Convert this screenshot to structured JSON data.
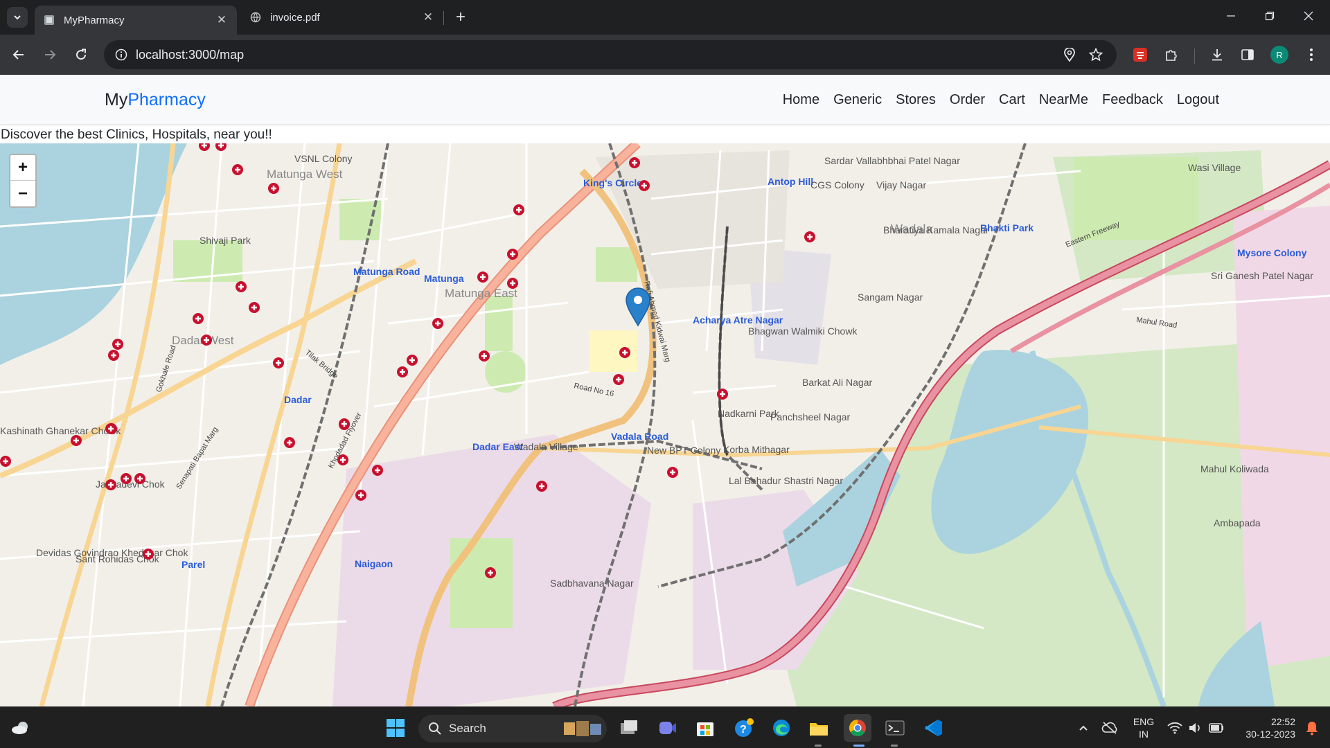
{
  "browser": {
    "tabs": [
      {
        "title": "MyPharmacy",
        "active": true
      },
      {
        "title": "invoice.pdf",
        "active": false
      }
    ],
    "url": "localhost:3000/map",
    "profile_initial": "R"
  },
  "page": {
    "brand": {
      "prefix": "My",
      "accent": "Pharmacy"
    },
    "nav": [
      {
        "label": "Home"
      },
      {
        "label": "Generic"
      },
      {
        "label": "Stores"
      },
      {
        "label": "Order"
      },
      {
        "label": "Cart"
      },
      {
        "label": "NearMe"
      },
      {
        "label": "Feedback"
      },
      {
        "label": "Logout"
      }
    ],
    "tagline": "Discover the best Clinics, Hospitals, near you!!",
    "map": {
      "zoom_in": "+",
      "zoom_out": "−",
      "labels": [
        {
          "text": "VSNL Colony"
        },
        {
          "text": "Matunga West"
        },
        {
          "text": "Shivaji Park"
        },
        {
          "text": "Dadar West"
        },
        {
          "text": "Matunga Road"
        },
        {
          "text": "Matunga"
        },
        {
          "text": "Matunga East"
        },
        {
          "text": "King's Circle"
        },
        {
          "text": "Antop Hill"
        },
        {
          "text": "CGS Colony"
        },
        {
          "text": "Vijay Nagar"
        },
        {
          "text": "Sardar Vallabhbhai Patel Nagar"
        },
        {
          "text": "Wadala"
        },
        {
          "text": "Bharatiya Kamala Nagar"
        },
        {
          "text": "Sangam Nagar"
        },
        {
          "text": "Acharya Atre Nagar"
        },
        {
          "text": "Bhagwan Walmiki Chowk"
        },
        {
          "text": "Barkat Ali Nagar"
        },
        {
          "text": "Bhakti Park"
        },
        {
          "text": "Wasi Village"
        },
        {
          "text": "Mysore Colony"
        },
        {
          "text": "Sri Ganesh Patel Nagar"
        },
        {
          "text": "Dadar"
        },
        {
          "text": "Dadar East"
        },
        {
          "text": "Wadala Village"
        },
        {
          "text": "Vadala Road"
        },
        {
          "text": "New BPT Colony"
        },
        {
          "text": "Nadkarni Park"
        },
        {
          "text": "Panchsheel Nagar"
        },
        {
          "text": "Korba Mithagar"
        },
        {
          "text": "Lal Bahadur Shastri Nagar"
        },
        {
          "text": "Mahul Koliwada"
        },
        {
          "text": "Ambapada"
        },
        {
          "text": "Naigaon"
        },
        {
          "text": "Parel"
        },
        {
          "text": "Sadbhavana Nagar"
        },
        {
          "text": "Kashinath Ghanekar Chowk"
        },
        {
          "text": "Jakbadevi Chok"
        },
        {
          "text": "Devidas Govindrao Khedekar Chok"
        },
        {
          "text": "Sant Rohidas Chok"
        },
        {
          "text": "Eastern Freeway"
        },
        {
          "text": "Mahul Road"
        },
        {
          "text": "Road No 16"
        },
        {
          "text": "Rafi Ahmed Kidwai Marg"
        },
        {
          "text": "Tilak Bridge"
        },
        {
          "text": "Senapati Bapat Marg"
        },
        {
          "text": "Gokhale Road"
        },
        {
          "text": "Khodadad Flyover"
        }
      ]
    }
  },
  "taskbar": {
    "search_label": "Search",
    "lang_line1": "ENG",
    "lang_line2": "IN",
    "time": "22:52",
    "date": "30-12-2023"
  },
  "colors": {
    "brand_accent": "#0d6efd",
    "hospital_marker": "#c8102e",
    "location_pin": "#2a81cb",
    "water": "#aad3df",
    "motorway": "#e892a2",
    "trunk": "#f9b29c"
  }
}
